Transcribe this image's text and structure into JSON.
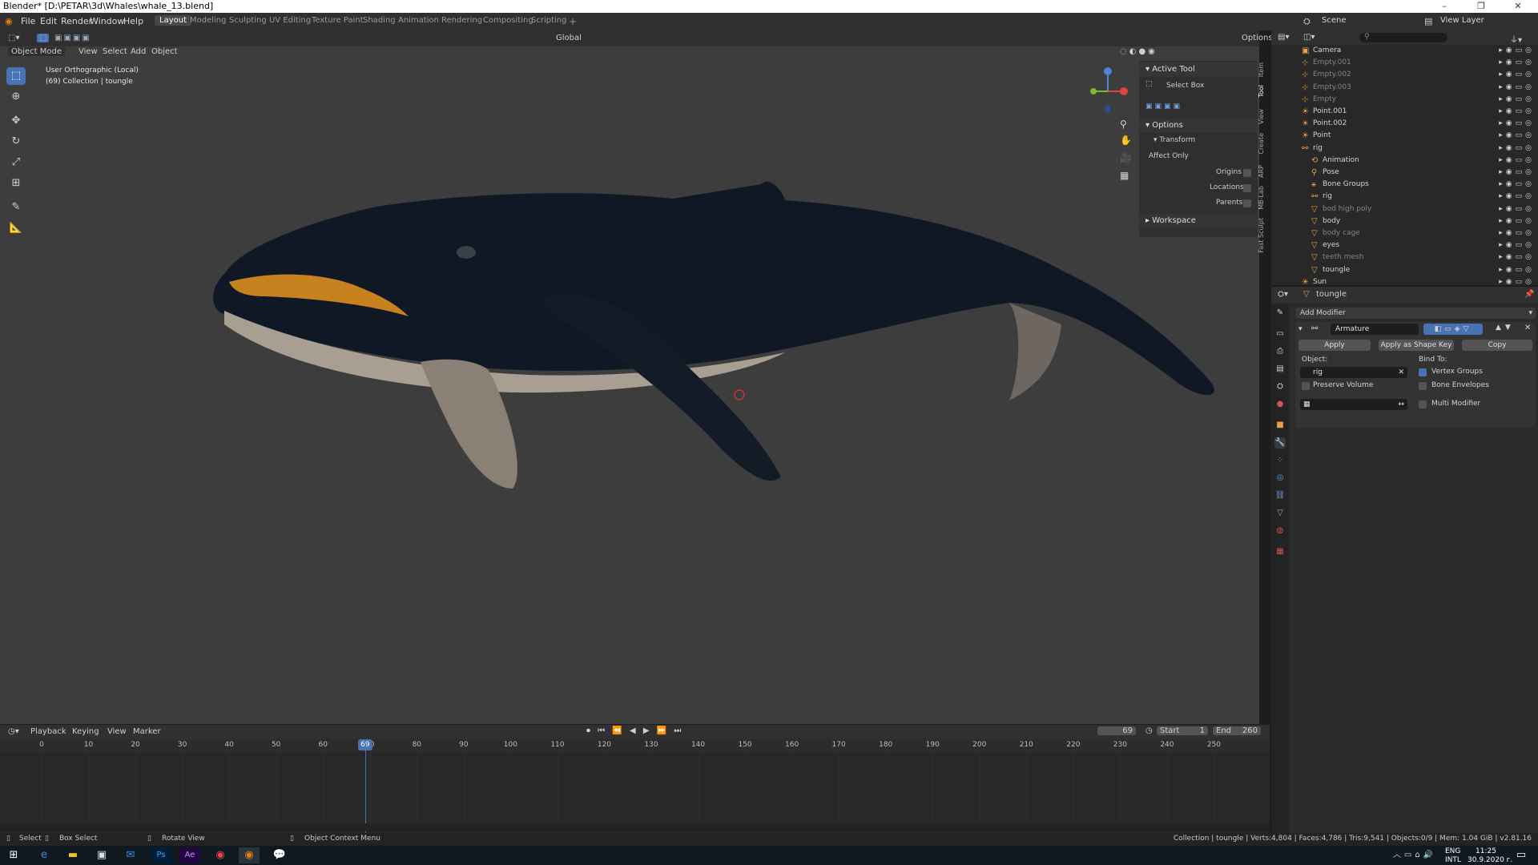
{
  "window": {
    "title": "Blender* [D:\\PETAR\\3d\\Whales\\whale_13.blend]",
    "minimize": "–",
    "maximize": "❐",
    "close": "✕"
  },
  "menus": [
    "File",
    "Edit",
    "Render",
    "Window",
    "Help"
  ],
  "workspaces": [
    "Layout",
    "Modeling",
    "Sculpting",
    "UV Editing",
    "Texture Paint",
    "Shading",
    "Animation",
    "Rendering",
    "Compositing",
    "Scripting"
  ],
  "scene": {
    "scene_name": "Scene",
    "view_layer": "View Layer"
  },
  "viewport_header": {
    "mode": "Object Mode",
    "menus": [
      "View",
      "Select",
      "Add",
      "Object"
    ],
    "orientation": "Global",
    "options": "Options"
  },
  "viewport": {
    "view_name": "User Orthographic (Local)",
    "collection_info": "(69) Collection | toungle"
  },
  "npanel": {
    "active_tool_header": "Active Tool",
    "tool_name": "Select Box",
    "options_header": "Options",
    "transform_header": "Transform",
    "affect_only": "Affect Only",
    "origins": "Origins",
    "locations": "Locations",
    "parents": "Parents",
    "workspace_header": "Workspace",
    "tabs": [
      "Item",
      "Tool",
      "View",
      "Create",
      "ARP",
      "MB-Lab",
      "Fast Sculpt"
    ]
  },
  "outliner": {
    "rows": [
      {
        "name": "Camera",
        "indent": 1,
        "icon": "camera-icon",
        "dim": false
      },
      {
        "name": "Empty.001",
        "indent": 1,
        "icon": "empty-icon",
        "dim": true
      },
      {
        "name": "Empty.002",
        "indent": 1,
        "icon": "empty-icon",
        "dim": true
      },
      {
        "name": "Empty.003",
        "indent": 1,
        "icon": "empty-icon",
        "dim": true
      },
      {
        "name": "Empty",
        "indent": 1,
        "icon": "empty-icon",
        "dim": true
      },
      {
        "name": "Point.001",
        "indent": 1,
        "icon": "light-icon",
        "dim": false
      },
      {
        "name": "Point.002",
        "indent": 1,
        "icon": "light-icon",
        "dim": false
      },
      {
        "name": "Point",
        "indent": 1,
        "icon": "light-icon",
        "dim": false
      },
      {
        "name": "rig",
        "indent": 1,
        "icon": "armature-icon",
        "dim": false
      },
      {
        "name": "Animation",
        "indent": 2,
        "icon": "animation-icon",
        "dim": false
      },
      {
        "name": "Pose",
        "indent": 2,
        "icon": "pose-icon",
        "dim": false
      },
      {
        "name": "Bone Groups",
        "indent": 2,
        "icon": "bone-groups-icon",
        "dim": false
      },
      {
        "name": "rig",
        "indent": 2,
        "icon": "armature-data-icon",
        "dim": false
      },
      {
        "name": "bod high poly",
        "indent": 2,
        "icon": "mesh-icon",
        "dim": true
      },
      {
        "name": "body",
        "indent": 2,
        "icon": "mesh-icon",
        "dim": false
      },
      {
        "name": "body cage",
        "indent": 2,
        "icon": "mesh-icon",
        "dim": true
      },
      {
        "name": "eyes",
        "indent": 2,
        "icon": "mesh-icon",
        "dim": false
      },
      {
        "name": "teeth mesh",
        "indent": 2,
        "icon": "mesh-icon",
        "dim": true
      },
      {
        "name": "toungle",
        "indent": 2,
        "icon": "mesh-icon",
        "dim": false
      },
      {
        "name": "Sun",
        "indent": 1,
        "icon": "sun-icon",
        "dim": false
      }
    ]
  },
  "properties": {
    "object_name": "toungle",
    "add_modifier": "Add Modifier",
    "modifier_name": "Armature",
    "apply": "Apply",
    "apply_shape": "Apply as Shape Key",
    "copy": "Copy",
    "object_label": "Object:",
    "object_value": "rig",
    "bind_to": "Bind To:",
    "vertex_groups": "Vertex Groups",
    "preserve_volume": "Preserve Volume",
    "bone_envelopes": "Bone Envelopes",
    "multi_modifier": "Multi Modifier"
  },
  "timeline": {
    "menus": [
      "Playback",
      "Keying",
      "View",
      "Marker"
    ],
    "current_frame": "69",
    "start_label": "Start",
    "start": "1",
    "end_label": "End",
    "end": "260",
    "ticks": [
      "0",
      "10",
      "20",
      "30",
      "40",
      "50",
      "60",
      "70",
      "80",
      "90",
      "100",
      "110",
      "120",
      "130",
      "140",
      "150",
      "160",
      "170",
      "180",
      "190",
      "200",
      "210",
      "220",
      "230",
      "240",
      "250"
    ],
    "frame_min": 0,
    "frame_max": 260
  },
  "statusbar": {
    "select": "Select",
    "box_select": "Box Select",
    "rotate_view": "Rotate View",
    "context_menu": "Object Context Menu",
    "stats": "Collection | toungle | Verts:4,804 | Faces:4,786 | Tris:9,541 | Objects:0/9 | Mem: 1.04 GiB | v2.81.16"
  },
  "taskbar": {
    "lang1": "ENG",
    "lang2": "INTL",
    "time": "11:25",
    "date": "30.9.2020 г."
  },
  "colors": {
    "accent": "#4772b3",
    "object_orange": "#e8a040",
    "viewport_bg": "#3d3d3d"
  }
}
